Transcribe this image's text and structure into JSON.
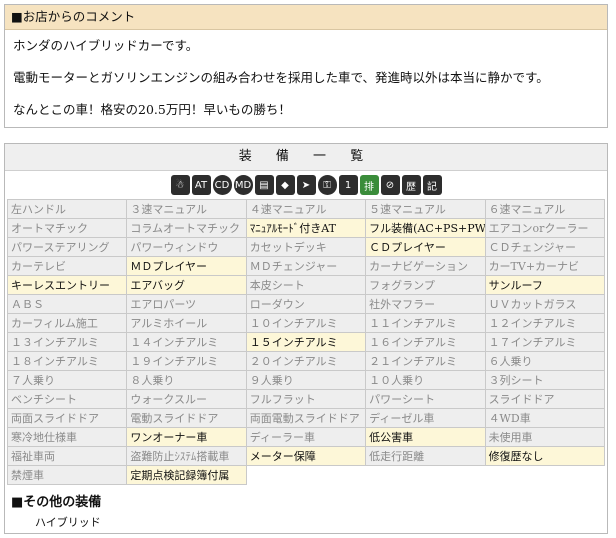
{
  "comment": {
    "header": "■お店からのコメント",
    "lines": [
      "ホンダのハイブリッドカーです。",
      "電動モーターとガソリンエンジンの組み合わせを採用した車で、発進時以外は本当に静かです。",
      "なんとこの車！格安の20.5万円！早いもの勝ち！"
    ]
  },
  "equipment": {
    "title": "装 備 一 覧",
    "icons": [
      "エアコン",
      "AT",
      "CD",
      "MD",
      "パワーウィンドウ",
      "ETC",
      "ナビ",
      "キーレス",
      "1オーナー",
      "排ガス適合",
      "禁煙",
      "履歴",
      "記録簿"
    ],
    "rows": [
      [
        {
          "label": "左ハンドル",
          "on": false
        },
        {
          "label": "３速マニュアル",
          "on": false
        },
        {
          "label": "４速マニュアル",
          "on": false
        },
        {
          "label": "５速マニュアル",
          "on": false
        },
        {
          "label": "６速マニュアル",
          "on": false
        }
      ],
      [
        {
          "label": "オートマチック",
          "on": false
        },
        {
          "label": "コラムオートマチック",
          "on": false
        },
        {
          "label": "ﾏﾆｭｱﾙﾓｰﾄﾞ付きAT",
          "on": true
        },
        {
          "label": "フル装備(AC+PS+PW)",
          "on": true
        },
        {
          "label": "エアコンorクーラー",
          "on": false
        }
      ],
      [
        {
          "label": "パワーステアリング",
          "on": false
        },
        {
          "label": "パワーウィンドウ",
          "on": false
        },
        {
          "label": "カセットデッキ",
          "on": false
        },
        {
          "label": "ＣＤプレイヤー",
          "on": true
        },
        {
          "label": "ＣＤチェンジャー",
          "on": false
        }
      ],
      [
        {
          "label": "カーテレビ",
          "on": false
        },
        {
          "label": "ＭＤプレイヤー",
          "on": true
        },
        {
          "label": "ＭＤチェンジャー",
          "on": false
        },
        {
          "label": "カーナビゲーション",
          "on": false
        },
        {
          "label": "カーTV+カーナビ",
          "on": false
        }
      ],
      [
        {
          "label": "キーレスエントリー",
          "on": true
        },
        {
          "label": "エアバッグ",
          "on": true
        },
        {
          "label": "本皮シート",
          "on": false
        },
        {
          "label": "フォグランプ",
          "on": false
        },
        {
          "label": "サンルーフ",
          "on": true
        }
      ],
      [
        {
          "label": "ＡＢＳ",
          "on": false
        },
        {
          "label": "エアロパーツ",
          "on": false
        },
        {
          "label": "ローダウン",
          "on": false
        },
        {
          "label": "社外マフラー",
          "on": false
        },
        {
          "label": "ＵＶカットガラス",
          "on": false
        }
      ],
      [
        {
          "label": "カーフィルム施工",
          "on": false
        },
        {
          "label": "アルミホイール",
          "on": false
        },
        {
          "label": "１０インチアルミ",
          "on": false
        },
        {
          "label": "１１インチアルミ",
          "on": false
        },
        {
          "label": "１２インチアルミ",
          "on": false
        }
      ],
      [
        {
          "label": "１３インチアルミ",
          "on": false
        },
        {
          "label": "１４インチアルミ",
          "on": false
        },
        {
          "label": "１５インチアルミ",
          "on": true
        },
        {
          "label": "１６インチアルミ",
          "on": false
        },
        {
          "label": "１７インチアルミ",
          "on": false
        }
      ],
      [
        {
          "label": "１８インチアルミ",
          "on": false
        },
        {
          "label": "１９インチアルミ",
          "on": false
        },
        {
          "label": "２０インチアルミ",
          "on": false
        },
        {
          "label": "２１インチアルミ",
          "on": false
        },
        {
          "label": "６人乗り",
          "on": false
        }
      ],
      [
        {
          "label": "７人乗り",
          "on": false
        },
        {
          "label": "８人乗り",
          "on": false
        },
        {
          "label": "９人乗り",
          "on": false
        },
        {
          "label": "１０人乗り",
          "on": false
        },
        {
          "label": "３列シート",
          "on": false
        }
      ],
      [
        {
          "label": "ベンチシート",
          "on": false
        },
        {
          "label": "ウォークスルー",
          "on": false
        },
        {
          "label": "フルフラット",
          "on": false
        },
        {
          "label": "パワーシート",
          "on": false
        },
        {
          "label": "スライドドア",
          "on": false
        }
      ],
      [
        {
          "label": "両面スライドドア",
          "on": false
        },
        {
          "label": "電動スライドドア",
          "on": false
        },
        {
          "label": "両面電動スライドドア",
          "on": false
        },
        {
          "label": "ディーゼル車",
          "on": false
        },
        {
          "label": "４WD車",
          "on": false
        }
      ],
      [
        {
          "label": "寒冷地仕様車",
          "on": false
        },
        {
          "label": "ワンオーナー車",
          "on": true
        },
        {
          "label": "ディーラー車",
          "on": false
        },
        {
          "label": "低公害車",
          "on": true
        },
        {
          "label": "未使用車",
          "on": false
        }
      ],
      [
        {
          "label": "福祉車両",
          "on": false
        },
        {
          "label": "盗難防止ｼｽﾃﾑ搭載車",
          "on": false
        },
        {
          "label": "メーター保障",
          "on": true
        },
        {
          "label": "低走行距離",
          "on": false
        },
        {
          "label": "修復歴なし",
          "on": true
        }
      ],
      [
        {
          "label": "禁煙車",
          "on": false
        },
        {
          "label": "定期点検記録簿付属",
          "on": true
        },
        {
          "label": "",
          "on": false,
          "empty": true
        },
        {
          "label": "",
          "on": false,
          "empty": true
        },
        {
          "label": "",
          "on": false,
          "empty": true
        }
      ]
    ]
  },
  "other": {
    "title": "■その他の装備",
    "items": [
      "ハイブリッド"
    ]
  }
}
